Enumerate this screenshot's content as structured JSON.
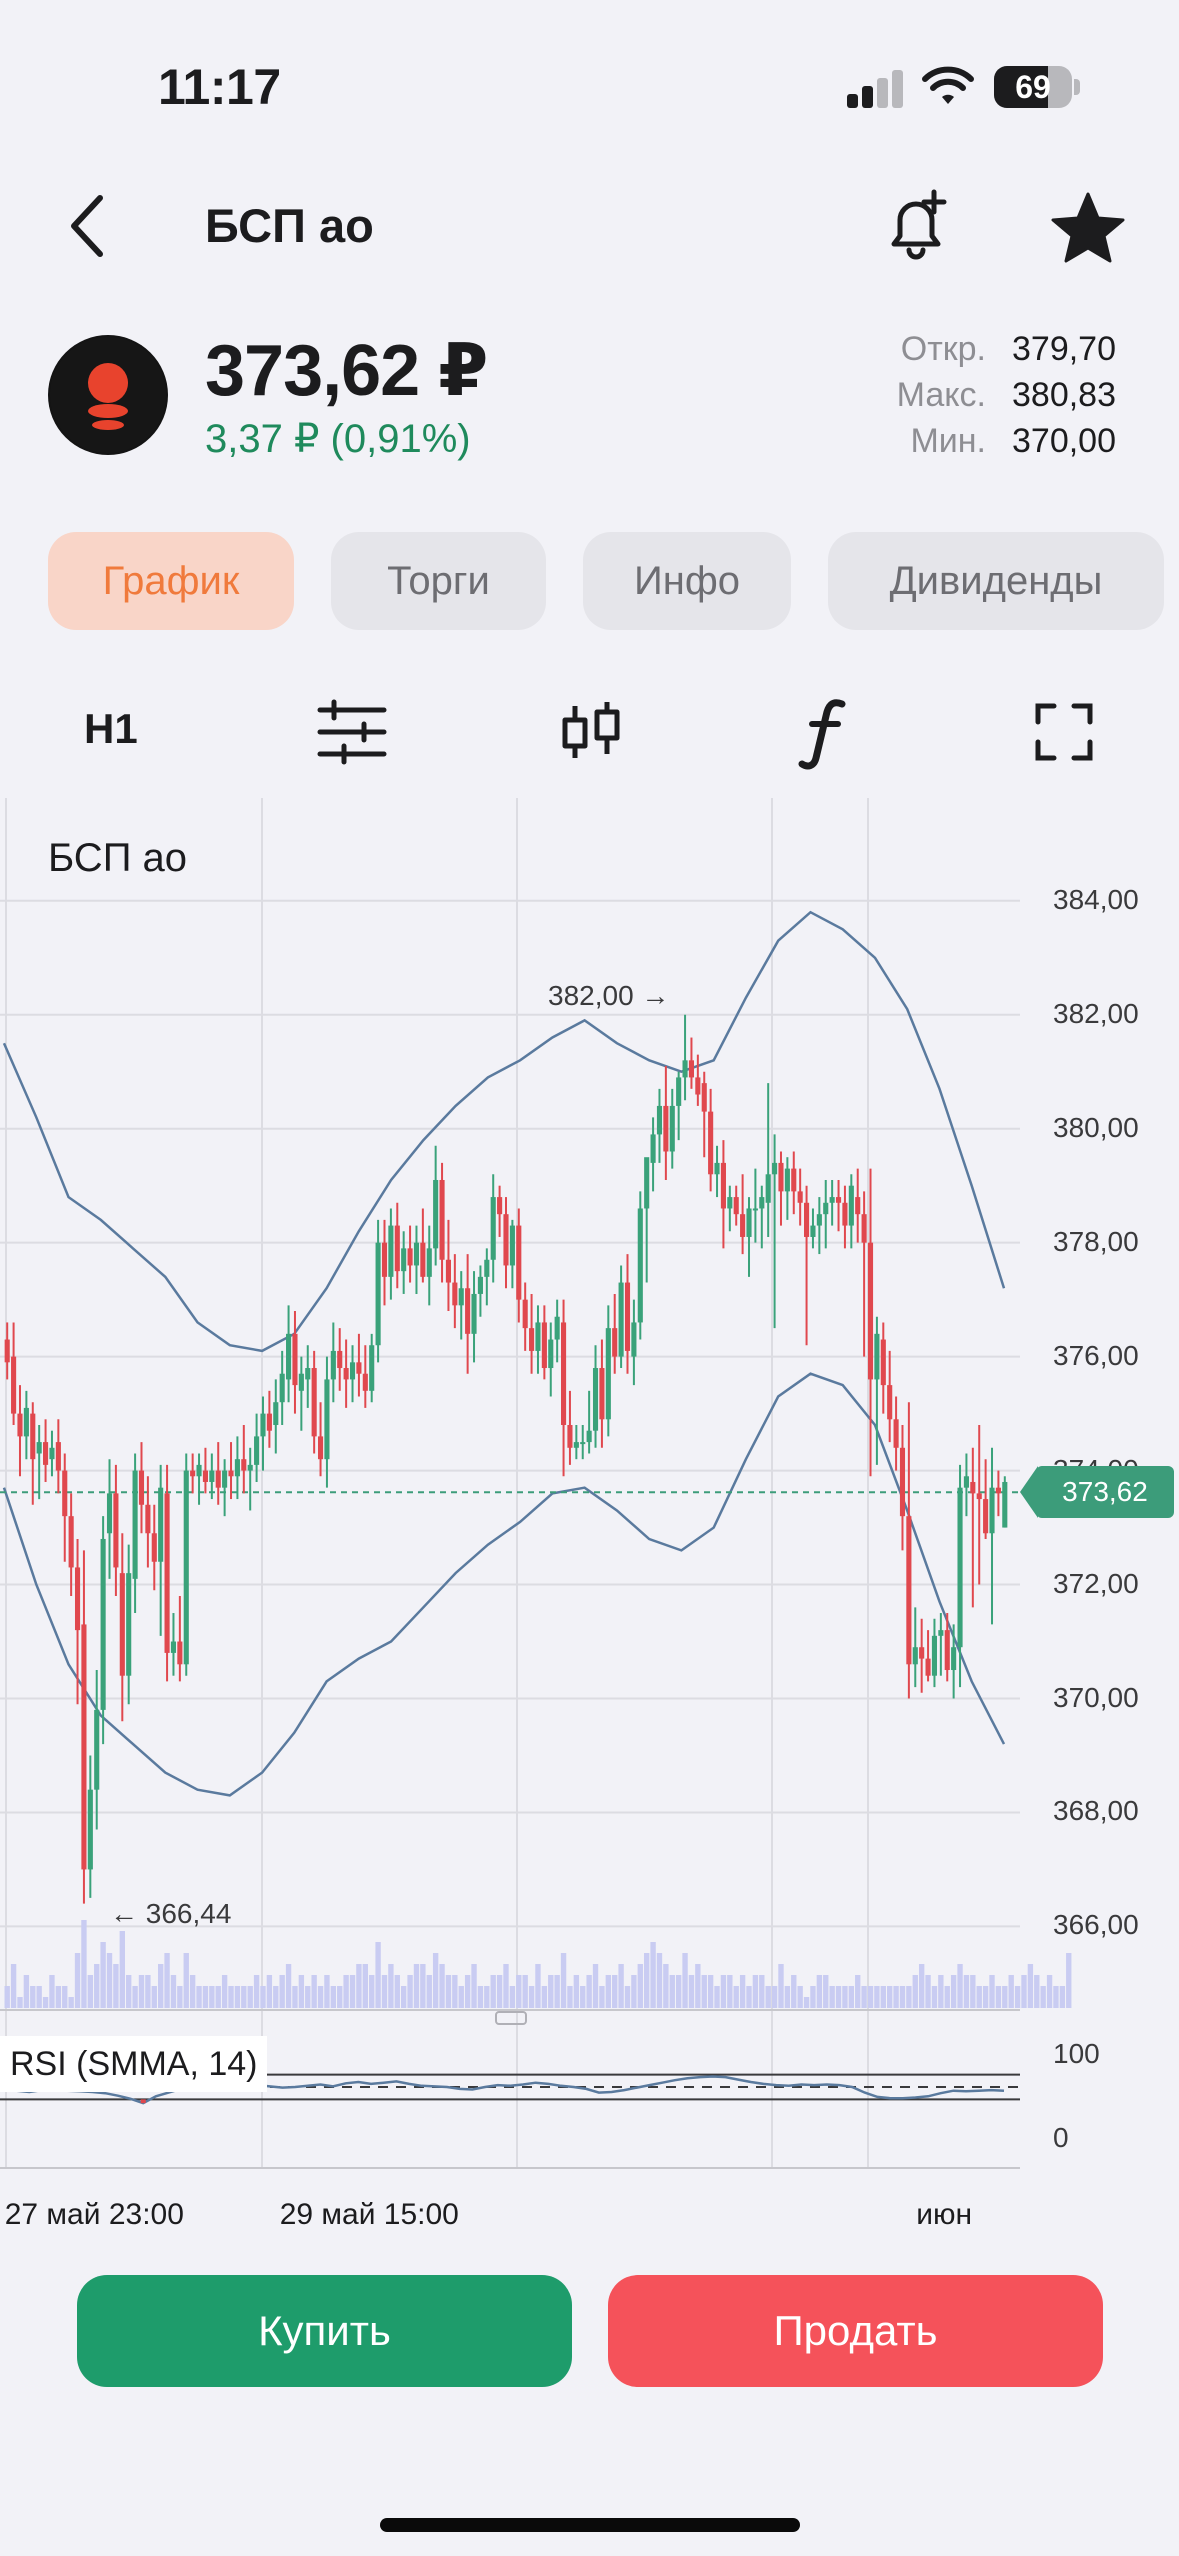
{
  "status_bar": {
    "time": "11:17",
    "battery": "69",
    "battery_level": 0.69
  },
  "header": {
    "title": "БСП ао"
  },
  "quote": {
    "price": "373,62 ₽",
    "change": "3,37 ₽ (0,91%)",
    "open_label": "Откр.",
    "open": "379,70",
    "high_label": "Макс.",
    "high": "380,83",
    "low_label": "Мин.",
    "low": "370,00"
  },
  "tabs": [
    {
      "label": "График",
      "active": true
    },
    {
      "label": "Торги",
      "active": false
    },
    {
      "label": "Инфо",
      "active": false
    },
    {
      "label": "Дивиденды",
      "active": false
    }
  ],
  "chart_toolbar": {
    "timeframe": "H1"
  },
  "chart": {
    "title": "БСП ао",
    "current_price_label": "373,62",
    "max_annotation": "382,00 →",
    "min_annotation": "← 366,44",
    "rsi_label": "RSI (SMMA, 14)",
    "rsi_ticks": [
      "100",
      "0"
    ]
  },
  "chart_data": {
    "type": "candlestick",
    "title": "БСП ао",
    "ylim": [
      365.2,
      384.4
    ],
    "y_ticks": [
      "384,00",
      "382,00",
      "380,00",
      "378,00",
      "376,00",
      "374,00",
      "372,00",
      "370,00",
      "368,00",
      "366,00"
    ],
    "x_ticks": [
      "27 май 23:00",
      "29 май 15:00",
      "июн"
    ],
    "x_tick_index": [
      15,
      58,
      146
    ],
    "current_price": 373.62,
    "max_marker": 382.0,
    "min_marker": 366.44,
    "candles": [
      [
        376.3,
        376.6,
        375.6,
        375.9
      ],
      [
        376.0,
        376.6,
        374.8,
        375.0
      ],
      [
        375.0,
        375.5,
        373.9,
        374.6
      ],
      [
        374.6,
        375.4,
        374.2,
        375.1
      ],
      [
        375.0,
        375.2,
        373.4,
        374.2
      ],
      [
        374.3,
        374.8,
        373.5,
        374.5
      ],
      [
        374.5,
        374.9,
        373.8,
        374.1
      ],
      [
        374.2,
        374.7,
        373.9,
        374.4
      ],
      [
        374.5,
        374.9,
        373.6,
        374.0
      ],
      [
        374.0,
        374.3,
        372.4,
        373.2
      ],
      [
        373.2,
        373.6,
        371.8,
        372.3
      ],
      [
        372.3,
        372.8,
        369.9,
        371.2
      ],
      [
        371.3,
        372.6,
        366.4,
        367.0
      ],
      [
        367.0,
        369.0,
        366.5,
        368.4
      ],
      [
        368.4,
        370.5,
        367.7,
        369.8
      ],
      [
        369.8,
        373.2,
        369.2,
        372.8
      ],
      [
        372.9,
        374.2,
        372.1,
        373.6
      ],
      [
        373.6,
        374.1,
        371.8,
        372.3
      ],
      [
        372.2,
        372.9,
        369.6,
        370.4
      ],
      [
        370.4,
        372.7,
        369.9,
        372.2
      ],
      [
        372.1,
        374.3,
        371.5,
        374.0
      ],
      [
        374.0,
        374.5,
        372.9,
        373.4
      ],
      [
        373.4,
        373.9,
        372.3,
        372.9
      ],
      [
        372.9,
        373.4,
        371.9,
        372.4
      ],
      [
        372.4,
        374.1,
        371.1,
        373.7
      ],
      [
        373.6,
        374.1,
        370.3,
        370.8
      ],
      [
        370.8,
        371.5,
        370.4,
        371.0
      ],
      [
        371.0,
        371.8,
        370.3,
        370.6
      ],
      [
        370.6,
        374.3,
        370.4,
        374.0
      ],
      [
        374.0,
        374.3,
        373.6,
        373.9
      ],
      [
        373.9,
        374.3,
        373.4,
        374.1
      ],
      [
        374.0,
        374.4,
        373.6,
        373.8
      ],
      [
        373.8,
        374.3,
        373.5,
        374.0
      ],
      [
        374.0,
        374.5,
        373.4,
        373.7
      ],
      [
        373.7,
        374.2,
        373.2,
        374.0
      ],
      [
        374.0,
        374.5,
        373.5,
        373.9
      ],
      [
        373.9,
        374.6,
        373.5,
        374.2
      ],
      [
        374.2,
        374.8,
        373.6,
        374.0
      ],
      [
        374.0,
        374.4,
        373.3,
        374.1
      ],
      [
        374.1,
        375.0,
        373.8,
        374.6
      ],
      [
        374.6,
        375.3,
        374.0,
        375.0
      ],
      [
        375.0,
        375.4,
        374.4,
        374.7
      ],
      [
        374.8,
        375.6,
        374.3,
        375.2
      ],
      [
        375.2,
        376.1,
        374.8,
        375.7
      ],
      [
        375.6,
        376.9,
        375.2,
        376.4
      ],
      [
        376.4,
        376.8,
        375.0,
        375.5
      ],
      [
        375.4,
        376.0,
        374.7,
        375.7
      ],
      [
        375.6,
        376.2,
        375.1,
        375.8
      ],
      [
        375.8,
        376.1,
        374.3,
        374.6
      ],
      [
        374.6,
        375.2,
        373.9,
        374.2
      ],
      [
        374.2,
        376.0,
        373.7,
        375.6
      ],
      [
        375.6,
        376.6,
        375.2,
        376.1
      ],
      [
        376.1,
        376.5,
        375.4,
        375.8
      ],
      [
        375.8,
        376.3,
        375.1,
        375.6
      ],
      [
        375.6,
        376.2,
        375.2,
        375.9
      ],
      [
        375.9,
        376.4,
        375.3,
        375.7
      ],
      [
        375.7,
        376.2,
        375.1,
        375.4
      ],
      [
        375.4,
        376.4,
        375.2,
        376.2
      ],
      [
        376.2,
        378.4,
        375.9,
        378.0
      ],
      [
        378.0,
        378.4,
        376.9,
        377.4
      ],
      [
        377.4,
        378.6,
        377.0,
        378.3
      ],
      [
        378.3,
        378.7,
        377.2,
        377.5
      ],
      [
        377.5,
        378.2,
        377.1,
        377.9
      ],
      [
        377.9,
        378.3,
        377.3,
        377.6
      ],
      [
        377.6,
        378.3,
        377.1,
        378.0
      ],
      [
        378.0,
        378.6,
        377.3,
        377.4
      ],
      [
        377.4,
        378.3,
        376.9,
        377.9
      ],
      [
        377.9,
        379.7,
        377.6,
        379.1
      ],
      [
        379.1,
        379.4,
        377.3,
        377.7
      ],
      [
        377.7,
        378.4,
        376.8,
        377.3
      ],
      [
        377.3,
        377.8,
        376.5,
        376.9
      ],
      [
        376.9,
        377.5,
        376.3,
        377.2
      ],
      [
        377.2,
        377.8,
        375.7,
        376.4
      ],
      [
        376.4,
        377.5,
        375.9,
        377.1
      ],
      [
        377.1,
        377.6,
        376.7,
        377.4
      ],
      [
        377.4,
        377.9,
        376.9,
        377.7
      ],
      [
        377.7,
        379.2,
        377.3,
        378.8
      ],
      [
        378.8,
        379.0,
        378.1,
        378.5
      ],
      [
        378.5,
        378.8,
        377.2,
        377.6
      ],
      [
        377.6,
        378.4,
        377.2,
        378.3
      ],
      [
        378.3,
        378.6,
        376.6,
        377.0
      ],
      [
        377.0,
        377.3,
        376.1,
        376.5
      ],
      [
        376.5,
        377.1,
        375.7,
        376.1
      ],
      [
        376.1,
        376.9,
        375.7,
        376.6
      ],
      [
        376.6,
        376.9,
        375.6,
        375.8
      ],
      [
        375.8,
        376.6,
        375.3,
        376.3
      ],
      [
        376.3,
        377.0,
        375.9,
        376.7
      ],
      [
        376.6,
        377.0,
        373.9,
        374.8
      ],
      [
        374.8,
        375.4,
        374.1,
        374.4
      ],
      [
        374.4,
        374.8,
        374.2,
        374.5
      ],
      [
        374.5,
        374.8,
        374.2,
        374.5
      ],
      [
        374.5,
        375.4,
        374.3,
        374.7
      ],
      [
        374.7,
        376.2,
        374.4,
        375.8
      ],
      [
        375.8,
        376.3,
        374.4,
        374.9
      ],
      [
        374.9,
        376.9,
        374.6,
        376.5
      ],
      [
        376.5,
        377.1,
        375.7,
        376.0
      ],
      [
        376.0,
        377.6,
        375.8,
        377.3
      ],
      [
        377.3,
        377.8,
        375.7,
        376.1
      ],
      [
        376.0,
        377.0,
        375.5,
        376.6
      ],
      [
        376.6,
        378.9,
        376.3,
        378.6
      ],
      [
        378.6,
        379.3,
        377.3,
        379.5
      ],
      [
        379.4,
        380.2,
        378.9,
        379.9
      ],
      [
        379.9,
        380.7,
        379.4,
        380.4
      ],
      [
        380.4,
        381.1,
        379.1,
        379.6
      ],
      [
        379.6,
        380.7,
        379.3,
        380.4
      ],
      [
        380.4,
        381.0,
        379.8,
        380.9
      ],
      [
        380.9,
        382.0,
        380.5,
        381.2
      ],
      [
        381.2,
        381.6,
        380.7,
        380.9
      ],
      [
        380.9,
        381.3,
        380.4,
        380.6
      ],
      [
        380.8,
        381.0,
        379.5,
        380.3
      ],
      [
        380.3,
        380.7,
        378.9,
        379.2
      ],
      [
        379.2,
        379.7,
        378.8,
        379.4
      ],
      [
        379.4,
        379.8,
        377.9,
        378.6
      ],
      [
        378.6,
        379.0,
        378.2,
        378.8
      ],
      [
        378.8,
        379.0,
        378.3,
        378.5
      ],
      [
        378.5,
        379.2,
        377.8,
        378.1
      ],
      [
        378.1,
        378.8,
        377.4,
        378.6
      ],
      [
        378.6,
        379.3,
        378.0,
        378.6
      ],
      [
        378.6,
        379.0,
        377.9,
        378.8
      ],
      [
        378.7,
        380.8,
        378.1,
        379.2
      ],
      [
        379.2,
        379.9,
        376.5,
        379.4
      ],
      [
        379.4,
        379.6,
        378.3,
        378.9
      ],
      [
        378.9,
        379.5,
        378.4,
        379.3
      ],
      [
        379.3,
        379.6,
        378.5,
        378.9
      ],
      [
        378.9,
        379.3,
        378.3,
        378.7
      ],
      [
        378.7,
        379.0,
        376.2,
        378.1
      ],
      [
        378.1,
        378.6,
        377.9,
        378.3
      ],
      [
        378.3,
        378.8,
        377.8,
        378.5
      ],
      [
        378.5,
        379.1,
        377.9,
        378.7
      ],
      [
        378.7,
        379.1,
        378.3,
        378.8
      ],
      [
        378.8,
        379.1,
        378.2,
        378.7
      ],
      [
        378.7,
        379.0,
        377.9,
        378.3
      ],
      [
        378.3,
        379.2,
        377.9,
        379.0
      ],
      [
        378.8,
        379.3,
        378.0,
        378.5
      ],
      [
        378.5,
        378.9,
        376.0,
        378.0
      ],
      [
        378.0,
        379.3,
        373.9,
        375.6
      ],
      [
        375.6,
        376.7,
        374.1,
        376.4
      ],
      [
        376.3,
        376.6,
        375.0,
        375.5
      ],
      [
        375.5,
        376.1,
        374.5,
        374.9
      ],
      [
        374.9,
        375.3,
        374.0,
        374.4
      ],
      [
        374.4,
        374.8,
        372.6,
        373.2
      ],
      [
        373.2,
        375.2,
        370.0,
        370.6
      ],
      [
        370.6,
        371.6,
        370.2,
        370.9
      ],
      [
        370.9,
        371.4,
        370.1,
        370.7
      ],
      [
        370.7,
        371.2,
        370.3,
        370.4
      ],
      [
        370.4,
        371.4,
        370.2,
        371.1
      ],
      [
        371.1,
        371.5,
        370.4,
        371.2
      ],
      [
        371.2,
        371.5,
        370.3,
        370.5
      ],
      [
        370.5,
        371.3,
        370.0,
        370.9
      ],
      [
        370.9,
        374.1,
        370.2,
        373.7
      ],
      [
        373.7,
        374.3,
        373.2,
        373.9
      ],
      [
        373.8,
        374.4,
        371.6,
        373.6
      ],
      [
        373.6,
        374.8,
        372.0,
        373.5
      ],
      [
        373.5,
        374.2,
        372.8,
        372.9
      ],
      [
        372.9,
        374.4,
        371.3,
        373.7
      ],
      [
        373.7,
        374.0,
        373.2,
        373.6
      ],
      [
        373.0,
        373.9,
        373.0,
        373.8
      ]
    ],
    "series": [
      {
        "values": [
          381.5,
          380.2,
          378.8,
          378.4,
          377.9,
          377.4,
          376.6,
          376.2,
          376.1,
          376.4,
          377.2,
          378.2,
          379.1,
          379.8,
          380.4,
          380.9,
          381.2,
          381.6,
          381.9,
          381.5,
          381.2,
          381.0,
          381.2,
          382.3,
          383.3,
          383.8,
          383.5,
          383.0,
          382.1,
          380.7,
          379.0,
          377.2
        ]
      },
      {
        "values": [
          373.7,
          372.0,
          370.6,
          369.7,
          369.2,
          368.7,
          368.4,
          368.3,
          368.7,
          369.4,
          370.3,
          370.7,
          371.0,
          371.6,
          372.2,
          372.7,
          373.1,
          373.6,
          373.7,
          373.3,
          372.8,
          372.6,
          373.0,
          374.2,
          375.3,
          375.7,
          375.5,
          374.8,
          373.3,
          371.7,
          370.3,
          369.2
        ]
      }
    ],
    "volume": [
      2,
      4,
      1,
      3,
      2,
      2,
      1,
      3,
      2,
      2,
      1,
      5,
      8,
      3,
      4,
      6,
      5,
      4,
      7,
      3,
      2,
      3,
      3,
      2,
      4,
      5,
      3,
      2,
      5,
      3,
      2,
      2,
      2,
      2,
      3,
      2,
      2,
      2,
      2,
      3,
      2,
      3,
      2,
      3,
      4,
      2,
      3,
      2,
      3,
      2,
      3,
      2,
      2,
      3,
      3,
      4,
      4,
      3,
      6,
      3,
      4,
      3,
      2,
      3,
      4,
      4,
      3,
      5,
      4,
      3,
      3,
      2,
      3,
      4,
      2,
      2,
      3,
      3,
      4,
      2,
      3,
      3,
      2,
      4,
      2,
      3,
      3,
      5,
      2,
      3,
      2,
      3,
      4,
      2,
      3,
      3,
      4,
      2,
      3,
      4,
      5,
      6,
      5,
      4,
      3,
      3,
      5,
      3,
      4,
      3,
      3,
      2,
      3,
      3,
      2,
      3,
      2,
      3,
      3,
      2,
      2,
      4,
      2,
      3,
      2,
      1,
      2,
      3,
      3,
      2,
      2,
      2,
      2,
      3,
      2,
      2,
      2,
      2,
      2,
      2,
      2,
      2,
      3,
      4,
      3,
      2,
      3,
      2,
      3,
      4,
      3,
      3,
      2,
      2,
      3,
      2,
      2,
      3,
      2,
      3,
      4,
      3,
      2,
      3,
      2,
      2,
      5
    ],
    "rsi_values": [
      46,
      44,
      42,
      45,
      46,
      44,
      43,
      42,
      40,
      36,
      31,
      24,
      35,
      41,
      47,
      54,
      50,
      45,
      51,
      55,
      53,
      51,
      49,
      50,
      52,
      54,
      51,
      56,
      58,
      55,
      57,
      59,
      55,
      52,
      51,
      50,
      47,
      46,
      50,
      53,
      52,
      54,
      57,
      55,
      52,
      50,
      47,
      41,
      42,
      45,
      49,
      53,
      57,
      61,
      64,
      66,
      67,
      66,
      62,
      58,
      55,
      53,
      52,
      54,
      53,
      54,
      53,
      50,
      41,
      34,
      32,
      32,
      33,
      35,
      40,
      44,
      43,
      44,
      45,
      44
    ]
  },
  "buttons": {
    "buy": "Купить",
    "sell": "Продать"
  },
  "colors": {
    "up": "#3aa27a",
    "down": "#e0484e",
    "band": "#5a7a9e",
    "accent": "#f07a3c"
  }
}
